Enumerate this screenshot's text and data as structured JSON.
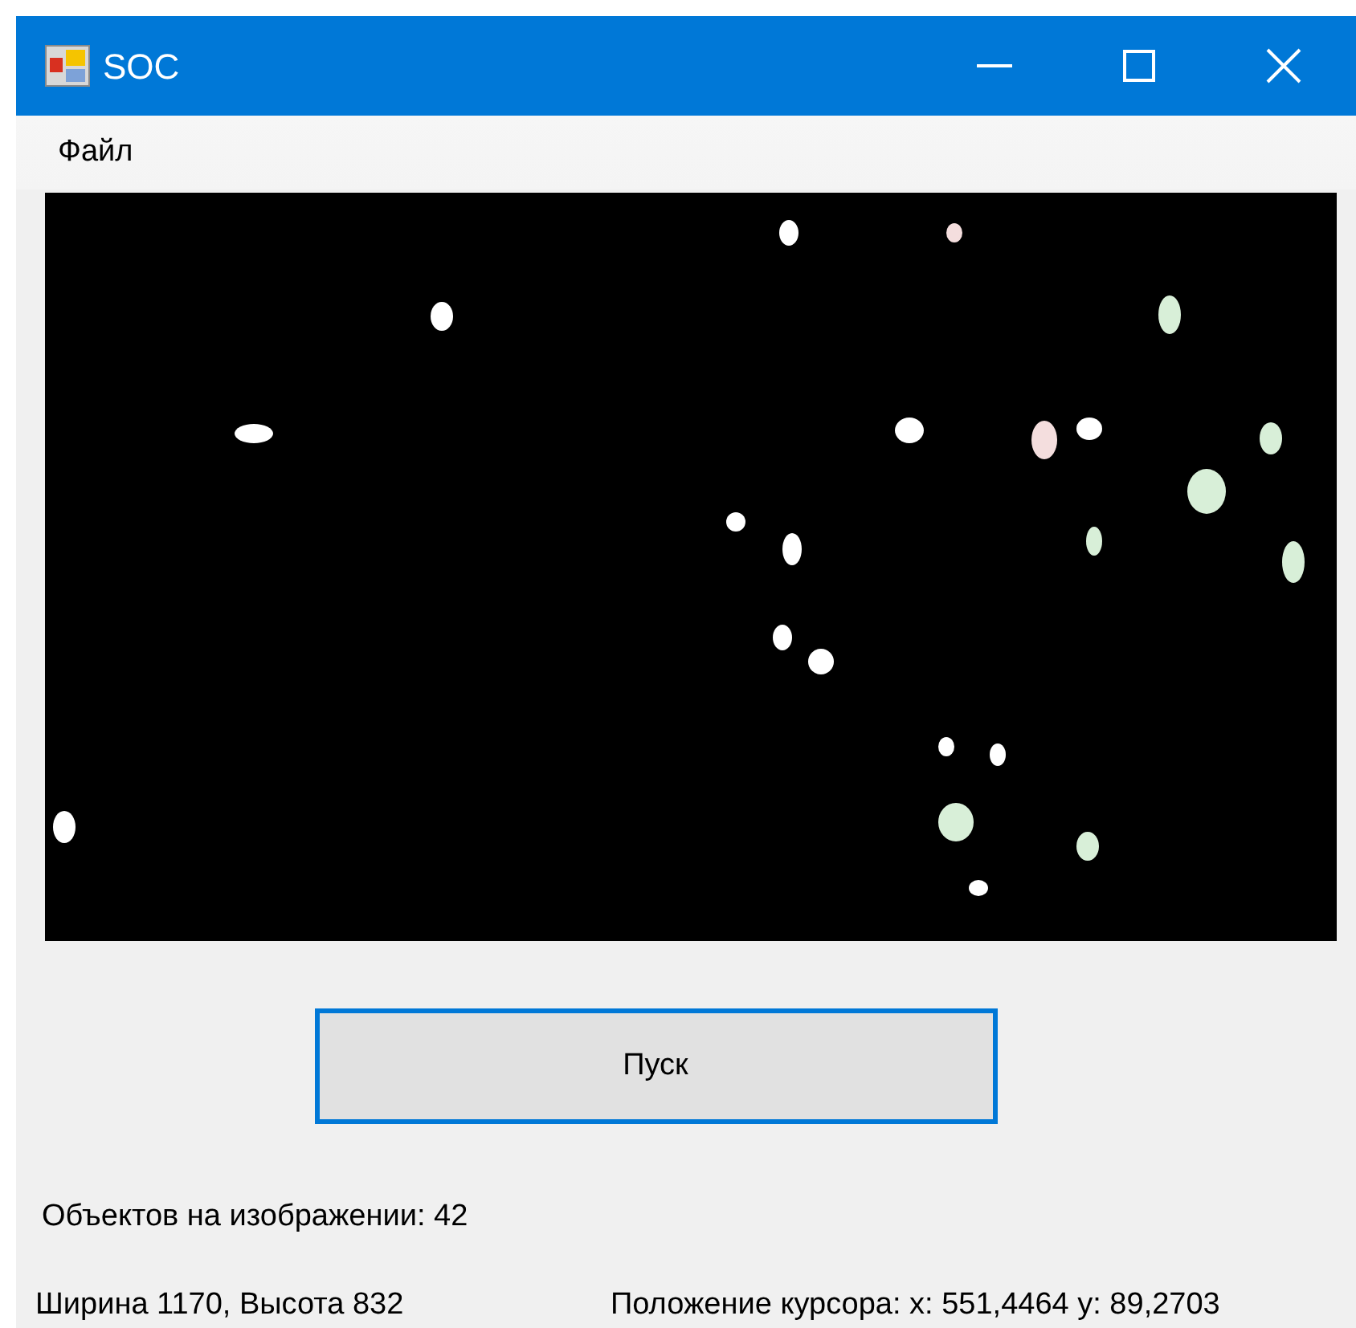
{
  "window": {
    "title": "SOC"
  },
  "menu": [
    "Файл"
  ],
  "start_button": {
    "label": "Пуск"
  },
  "objects_label": "Объектов на изображении: 42",
  "status": {
    "size": "Ширина 1170, Высота 832",
    "cursor": "Положение курсора: x: 551,4464 y: 89,2703"
  }
}
